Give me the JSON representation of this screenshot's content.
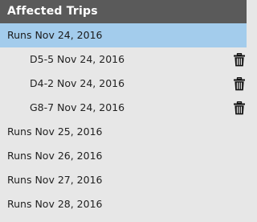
{
  "panel": {
    "title": "Affected Trips"
  },
  "dates": [
    {
      "label": "Runs Nov 24, 2016",
      "selected": true,
      "trips": [
        {
          "label": "D5-5 Nov 24, 2016",
          "delete_icon": "trash-icon"
        },
        {
          "label": "D4-2 Nov 24, 2016",
          "delete_icon": "trash-icon"
        },
        {
          "label": "G8-7 Nov 24, 2016",
          "delete_icon": "trash-icon"
        }
      ]
    },
    {
      "label": "Runs Nov 25, 2016",
      "selected": false,
      "trips": []
    },
    {
      "label": "Runs Nov 26, 2016",
      "selected": false,
      "trips": []
    },
    {
      "label": "Runs Nov 27, 2016",
      "selected": false,
      "trips": []
    },
    {
      "label": "Runs Nov 28, 2016",
      "selected": false,
      "trips": []
    }
  ],
  "colors": {
    "header_bg": "#5a5a5a",
    "panel_bg": "#e7e7e7",
    "selected_bg": "#a3ccec"
  }
}
